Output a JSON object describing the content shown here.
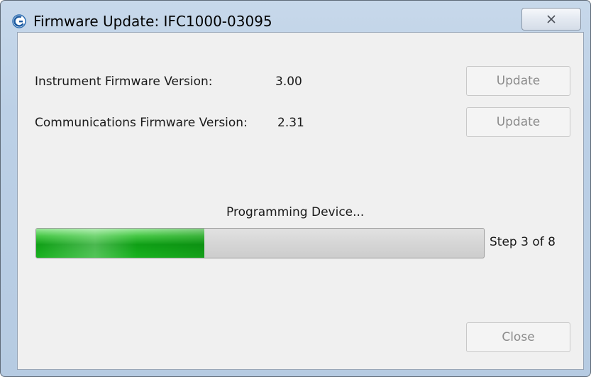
{
  "window": {
    "title": "Firmware Update: IFC1000-03095",
    "close_glyph": "✕"
  },
  "instrument": {
    "label": "Instrument Firmware Version:",
    "value": "3.00",
    "button_label": "Update"
  },
  "communications": {
    "label": "Communications Firmware Version:",
    "value": "2.31",
    "button_label": "Update"
  },
  "progress": {
    "status_text": "Programming Device...",
    "fraction": 0.375,
    "step_text": "Step 3 of 8"
  },
  "footer": {
    "close_label": "Close"
  },
  "colors": {
    "progress_green": "#0fa016",
    "disabled_text": "#8c8c8c",
    "window_frame": "#bcd0e6"
  },
  "icons": {
    "app": "app-logo-icon",
    "close": "close-icon"
  }
}
